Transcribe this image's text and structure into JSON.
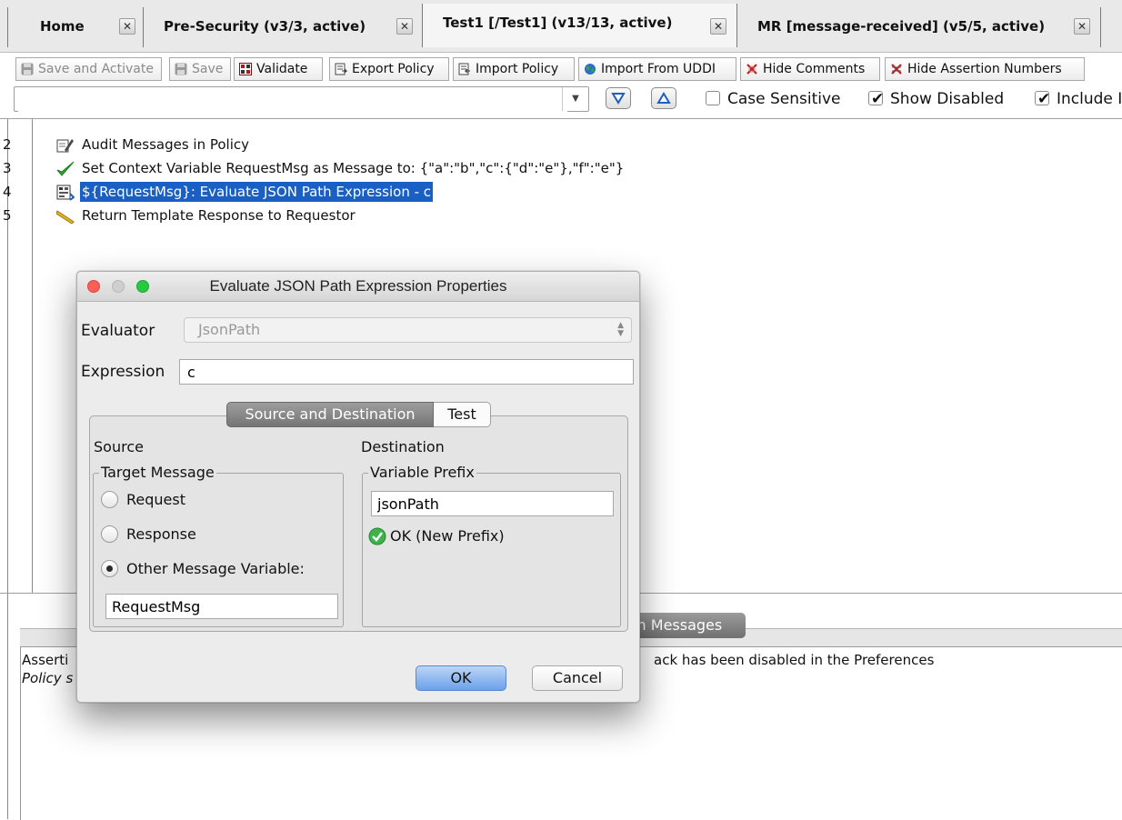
{
  "tabs": [
    {
      "label": "Home"
    },
    {
      "label": "Pre-Security (v3/3, active)"
    },
    {
      "label": "Test1 [/Test1] (v13/13, active)"
    },
    {
      "label": "MR [message-received] (v5/5, active)"
    }
  ],
  "close_glyph": "✕",
  "toolbar": {
    "save_activate": "Save and Activate",
    "save": "Save",
    "validate": "Validate",
    "export_policy": "Export Policy",
    "import_policy": "Import Policy",
    "import_uddi": "Import From UDDI",
    "hide_comments": "Hide Comments",
    "hide_numbers": "Hide Assertion Numbers"
  },
  "search": {
    "value": "",
    "case_sensitive_label": "Case Sensitive",
    "case_sensitive": false,
    "show_disabled_label": "Show Disabled",
    "show_disabled": true,
    "include_label": "Include I",
    "include": true
  },
  "policy": {
    "rows": [
      {
        "num": "2",
        "text": "Audit Messages in Policy",
        "icon": "audit-icon"
      },
      {
        "num": "3",
        "text": "Set Context Variable RequestMsg as Message to: {\"a\":\"b\",\"c\":{\"d\":\"e\"},\"f\":\"e\"}",
        "icon": "checkmark-icon"
      },
      {
        "num": "4",
        "text": "${RequestMsg}: Evaluate JSON Path Expression - c",
        "icon": "json-path-icon",
        "selected": true
      },
      {
        "num": "5",
        "text": "Return Template Response to Requestor",
        "icon": "template-response-icon"
      }
    ]
  },
  "bottom": {
    "tab_label": "on Messages",
    "message_line1_start": "Asserti",
    "message_line1_end": "ack has been disabled in the Preferences",
    "message_line2_start": "Policy s"
  },
  "dialog": {
    "title": "Evaluate JSON Path Expression Properties",
    "evaluator_label": "Evaluator",
    "evaluator_value": "JsonPath",
    "expression_label": "Expression",
    "expression_value": "c",
    "tabs": {
      "source_dest": "Source and Destination",
      "test": "Test"
    },
    "source_label": "Source",
    "destination_label": "Destination",
    "target_message_title": "Target Message",
    "radio_request": "Request",
    "radio_response": "Response",
    "radio_other": "Other Message Variable:",
    "selected_radio": "other",
    "other_variable_value": "RequestMsg",
    "variable_prefix_title": "Variable Prefix",
    "variable_prefix_value": "jsonPath",
    "prefix_status": "OK (New Prefix)",
    "ok_button": "OK",
    "cancel_button": "Cancel"
  },
  "colors": {
    "selection": "#1a5fc4",
    "ok_button": "#6aa1ea",
    "traffic_red": "#fc5f57",
    "traffic_gray": "#cfcfcf",
    "traffic_green": "#28c840"
  }
}
